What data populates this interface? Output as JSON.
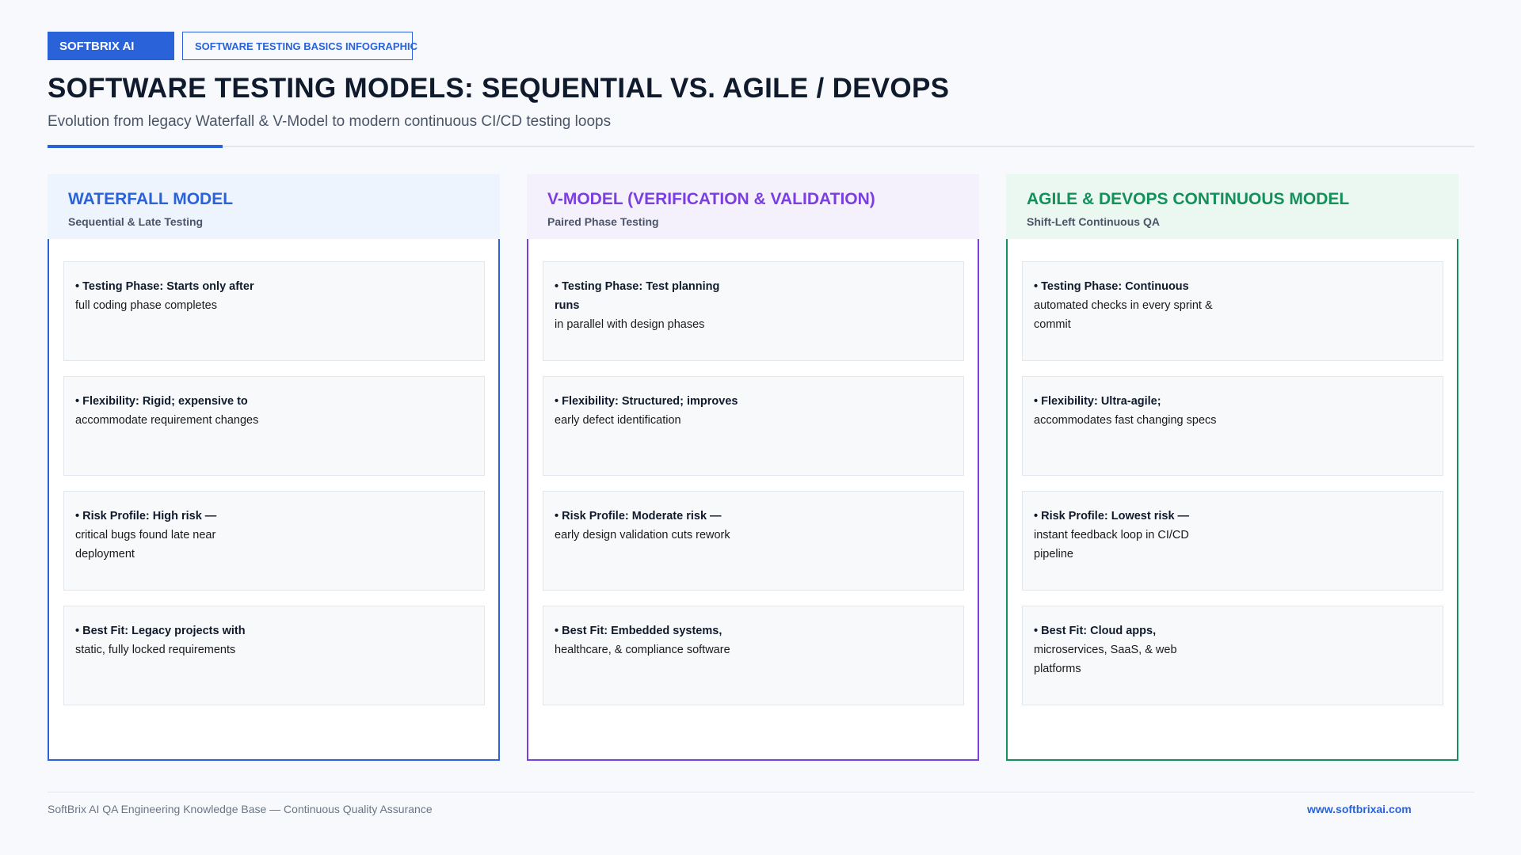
{
  "header": {
    "brand": "SOFTBRIX AI",
    "tag": "SOFTWARE TESTING BASICS INFOGRAPHIC",
    "title": "SOFTWARE TESTING MODELS: SEQUENTIAL VS. AGILE / DEVOPS",
    "subtitle": "Evolution from legacy Waterfall & V-Model to modern continuous CI/CD testing loops"
  },
  "colors": {
    "waterfall": "#2962d9",
    "vmodel": "#7b3fe0",
    "agile": "#14905a"
  },
  "columns": [
    {
      "title": "WATERFALL MODEL",
      "subtitle": "Sequential & Late Testing",
      "cards": [
        {
          "lead": "• Testing Phase: Starts only after",
          "body": "full coding phase completes"
        },
        {
          "lead": "• Flexibility: Rigid; expensive to",
          "body": "accommodate requirement changes"
        },
        {
          "lead": "• Risk Profile: High risk —",
          "body": "critical bugs found late near deployment"
        },
        {
          "lead": "• Best Fit: Legacy projects with",
          "body": "static, fully locked requirements"
        }
      ]
    },
    {
      "title": "V-MODEL (VERIFICATION & VALIDATION)",
      "subtitle": "Paired Phase Testing",
      "cards": [
        {
          "lead": "• Testing Phase: Test planning runs",
          "body": "in parallel with design phases"
        },
        {
          "lead": "• Flexibility: Structured; improves",
          "body": "early defect identification"
        },
        {
          "lead": "• Risk Profile: Moderate risk —",
          "body": "early design validation cuts rework"
        },
        {
          "lead": "• Best Fit: Embedded systems,",
          "body": "healthcare, & compliance software"
        }
      ]
    },
    {
      "title": "AGILE & DEVOPS CONTINUOUS MODEL",
      "subtitle": "Shift-Left Continuous QA",
      "cards": [
        {
          "lead": "• Testing Phase: Continuous",
          "body": "automated checks in every sprint & commit"
        },
        {
          "lead": "• Flexibility: Ultra-agile;",
          "body": "accommodates fast changing specs"
        },
        {
          "lead": "• Risk Profile: Lowest risk —",
          "body": "instant feedback loop in CI/CD pipeline"
        },
        {
          "lead": "• Best Fit: Cloud apps,",
          "body": "microservices, SaaS, & web platforms"
        }
      ]
    }
  ],
  "footer": {
    "text": "SoftBrix AI QA Engineering Knowledge Base — Continuous Quality Assurance",
    "link": "www.softbrixai.com"
  }
}
